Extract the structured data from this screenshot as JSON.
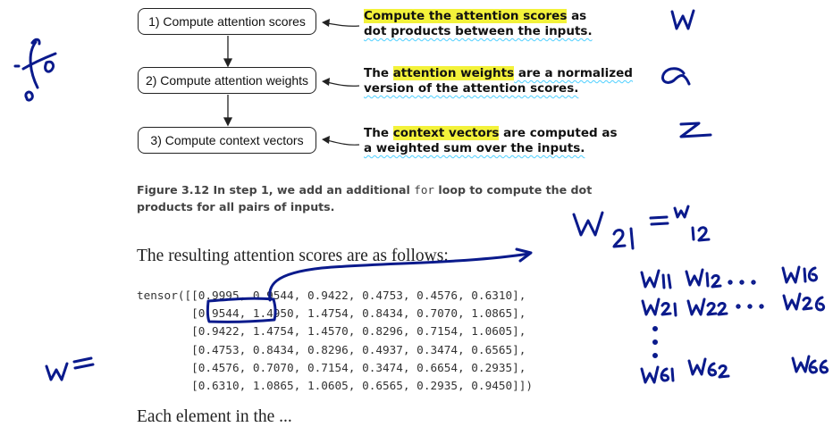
{
  "flow": {
    "steps": [
      "1) Compute attention scores",
      "2) Compute attention weights",
      "3) Compute context vectors"
    ],
    "notes": [
      {
        "l1a": "Compute the attention scores",
        "l1b": " as",
        "l2": "dot products between the inputs."
      },
      {
        "l1a": "The ",
        "l1b": "attention weights",
        "l1c": " are a normalized",
        "l2": "version of the attention scores."
      },
      {
        "l1a": "The ",
        "l1b": "context vectors",
        "l1c": " are computed as",
        "l2": "a weighted sum over the inputs."
      }
    ]
  },
  "caption": {
    "part1": "Figure 3.12   In step 1, we add an additional ",
    "code": "for",
    "part2": " loop to compute the dot",
    "line2": "products for all pairs of inputs."
  },
  "body": {
    "sentence": "The resulting attention scores are as follows:",
    "code_lines": [
      "tensor([[0.9995, 0.9544, 0.9422, 0.4753, 0.4576, 0.6310],",
      "        [0.9544, 1.4950, 1.4754, 0.8434, 0.7070, 1.0865],",
      "        [0.9422, 1.4754, 1.4570, 0.8296, 0.7154, 1.0605],",
      "        [0.4753, 0.8434, 0.8296, 0.4937, 0.3474, 0.6565],",
      "        [0.4576, 0.7070, 0.7154, 0.3474, 0.6654, 0.2935],",
      "        [0.6310, 1.0865, 1.0605, 0.6565, 0.2935, 0.9450]])"
    ],
    "cut_line": "Each element in the ... "
  },
  "handwriting": {
    "w_top": "W",
    "alpha": "α",
    "z": "z",
    "w21_eq_w12": [
      "W",
      "21",
      "=",
      "W",
      "12"
    ],
    "w_dash": "W=",
    "matrix_row1": [
      "W11",
      "W12 . . .",
      "W16"
    ],
    "matrix_row2": [
      "W21",
      "W22 . . .",
      "W26"
    ],
    "matrix_row3": [
      "W61",
      "W62",
      "W66"
    ]
  },
  "colors": {
    "highlight": "#f3f23a",
    "ink": "#0a1a8c",
    "spellcheck": "#4fd0ff"
  }
}
